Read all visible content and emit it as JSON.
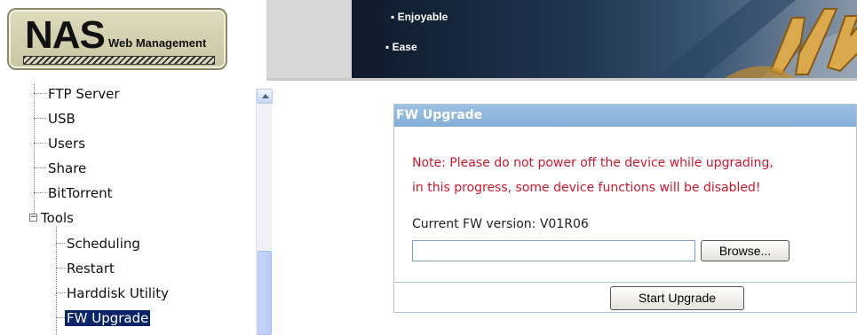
{
  "header": {
    "logo_nas": "NAS",
    "logo_sub": "Web Management",
    "banner_lines": [
      "▪ Enjoyable",
      "▪ Ease"
    ]
  },
  "sidebar": {
    "items": [
      {
        "label": "FTP Server"
      },
      {
        "label": "USB"
      },
      {
        "label": "Users"
      },
      {
        "label": "Share"
      },
      {
        "label": "BitTorrent"
      },
      {
        "label": "Tools",
        "expander": "−"
      },
      {
        "label": "Scheduling"
      },
      {
        "label": "Restart"
      },
      {
        "label": "Harddisk Utility"
      },
      {
        "label": "FW Upgrade",
        "selected": true
      }
    ]
  },
  "panel": {
    "title": "FW Upgrade",
    "note_line1": "Note: Please do not power off the device while upgrading,",
    "note_line2": "in this progress, some device functions will be disabled!",
    "current_version_label": "Current FW version: V01R06",
    "file_value": "",
    "browse_label": "Browse...",
    "start_label": "Start Upgrade"
  },
  "colors": {
    "panel_title_bg": "#8fb6dd",
    "note_text": "#d0172e",
    "selected_bg": "#0a246a"
  },
  "icons": [
    "scroll-up-arrow-icon",
    "tree-collapse-icon"
  ]
}
